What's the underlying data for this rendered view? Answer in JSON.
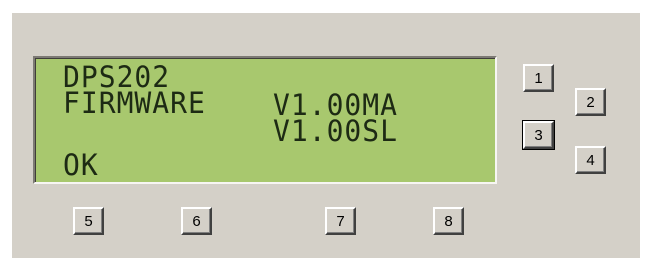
{
  "lcd": {
    "lines": [
      "DPS202",
      "FIRMWARE",
      "V1.00MA",
      "V1.00SL",
      "OK"
    ]
  },
  "buttons": [
    {
      "label": "1"
    },
    {
      "label": "2"
    },
    {
      "label": "3"
    },
    {
      "label": "4"
    },
    {
      "label": "5"
    },
    {
      "label": "6"
    },
    {
      "label": "7"
    },
    {
      "label": "8"
    }
  ],
  "colors": {
    "panel": "#d4d0c8",
    "lcd_background": "#a8c86e",
    "lcd_text": "#1d2a14"
  }
}
